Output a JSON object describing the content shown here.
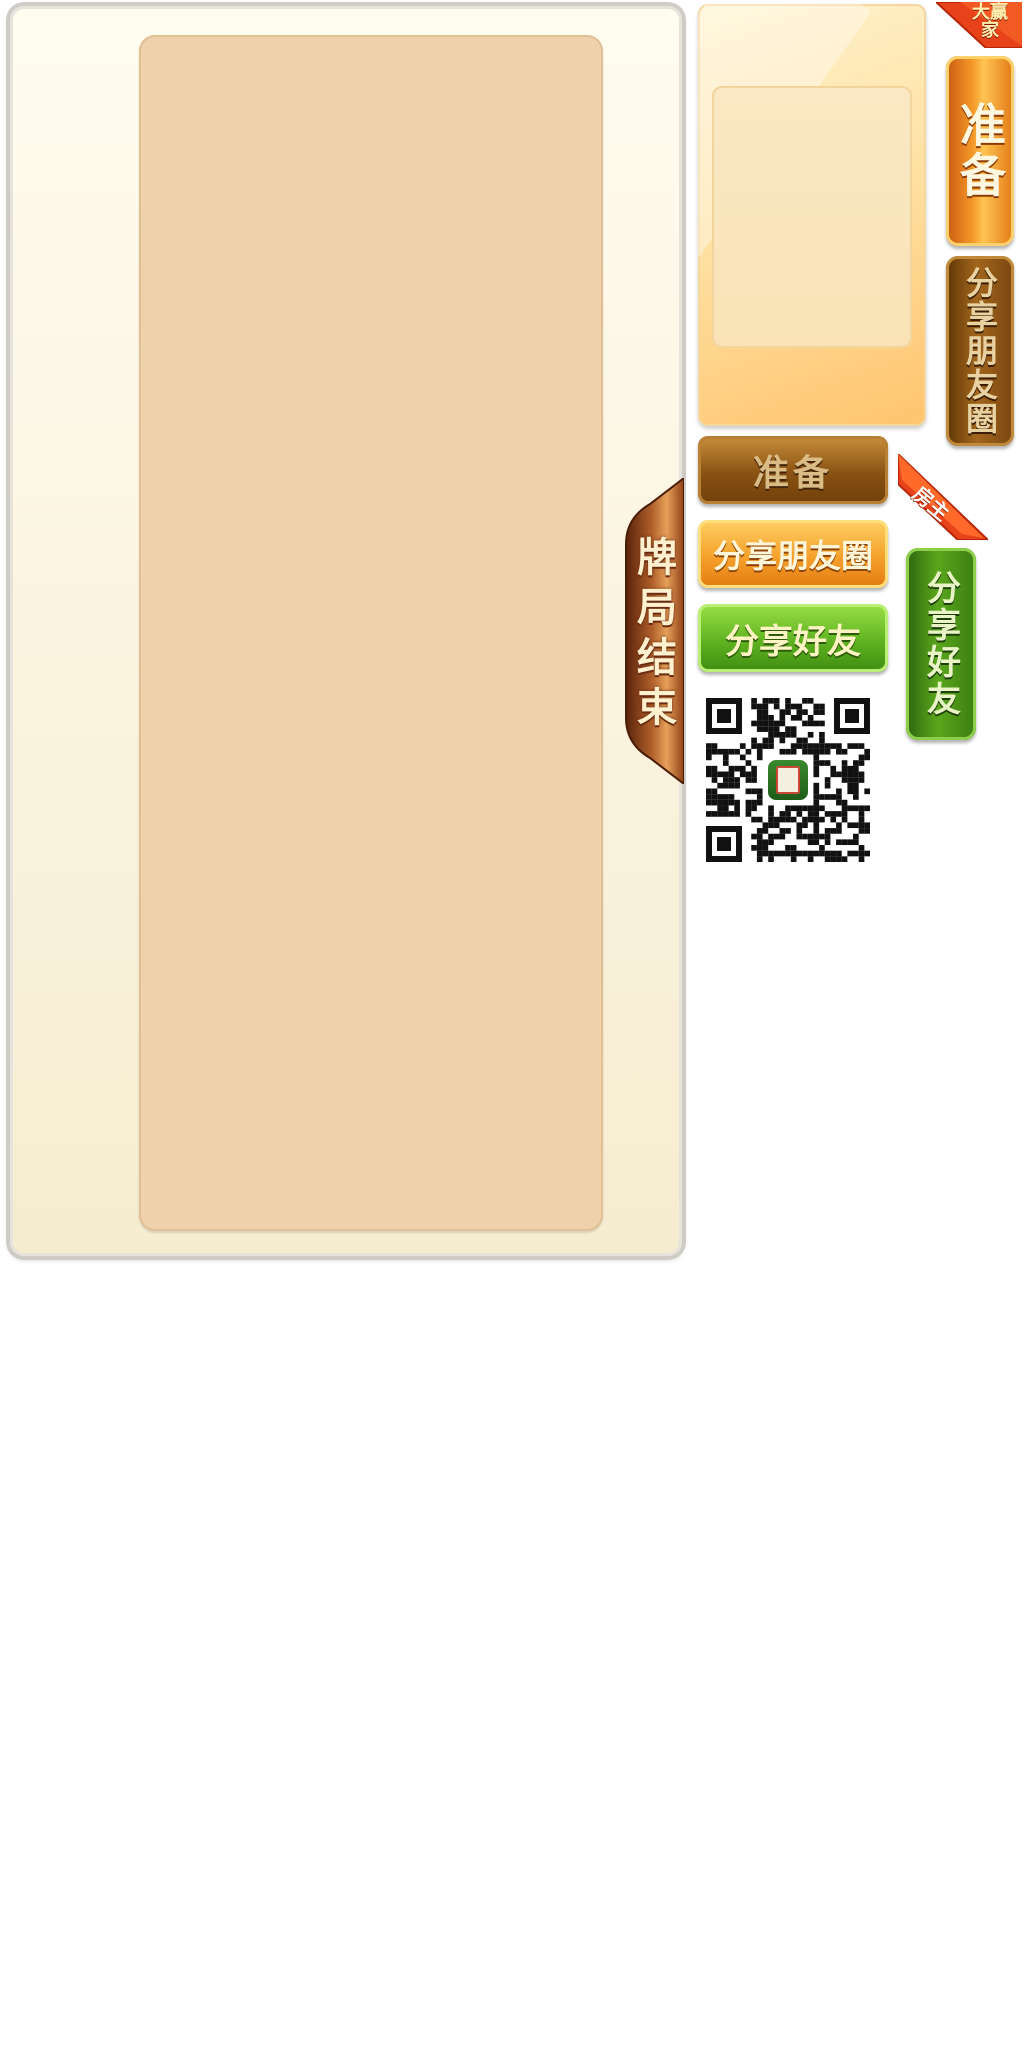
{
  "result_panel": {
    "end_tab_label": "牌局结束"
  },
  "buttons": {
    "ready_vertical": "准备",
    "share_moments_vertical": "分享朋友圈",
    "share_friend_vertical": "分享好友",
    "ready_horizontal": "准备",
    "share_moments_horizontal": "分享朋友圈",
    "share_friend_horizontal": "分享好友"
  },
  "badges": {
    "winner": "大赢家",
    "host": "房主"
  },
  "colors": {
    "panel_bg": "#f8f0d6",
    "panel_inner": "#efd1ab",
    "orange": "#f59a2a",
    "brown": "#8a5212",
    "green": "#5fb320",
    "ribbon_red": "#e8421a"
  },
  "icons": {
    "qr": "qr-code-icon",
    "app_logo": "mahjong-app-icon"
  }
}
